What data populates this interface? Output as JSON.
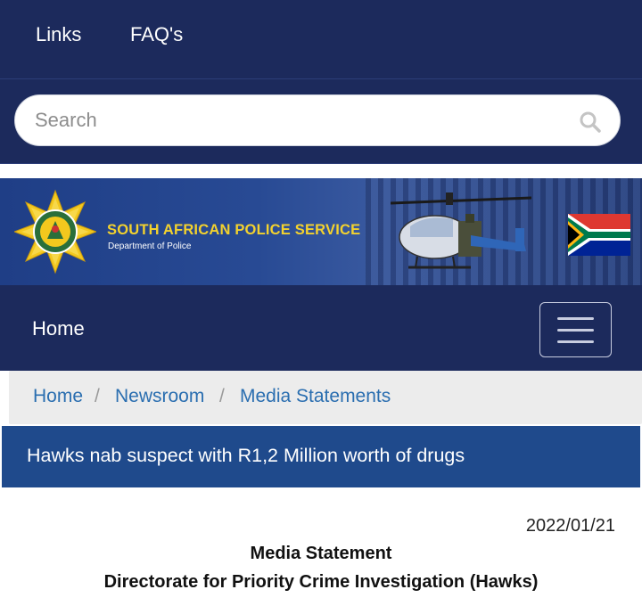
{
  "top_nav": {
    "links_label": "Links",
    "faq_label": "FAQ's"
  },
  "search": {
    "placeholder": "Search"
  },
  "banner": {
    "org_name": "SOUTH AFRICAN POLICE SERVICE",
    "department": "Department of Police",
    "badge_text": "SOUTH AFRICAN POLICE SERVICE"
  },
  "home_bar": {
    "home_label": "Home"
  },
  "breadcrumb": {
    "items": [
      "Home",
      "Newsroom",
      "Media Statements"
    ],
    "separator": "/"
  },
  "article": {
    "title": "Hawks nab suspect with R1,2 Million worth of drugs",
    "date": "2022/01/21",
    "statement_label": "Media Statement",
    "directorate": "Directorate for Priority Crime Investigation (Hawks)"
  },
  "colors": {
    "nav_bg": "#1c2a5c",
    "title_bar_bg": "#1f4a8c",
    "breadcrumb_link": "#2a6eb0",
    "badge_gold": "#f3d22e"
  }
}
